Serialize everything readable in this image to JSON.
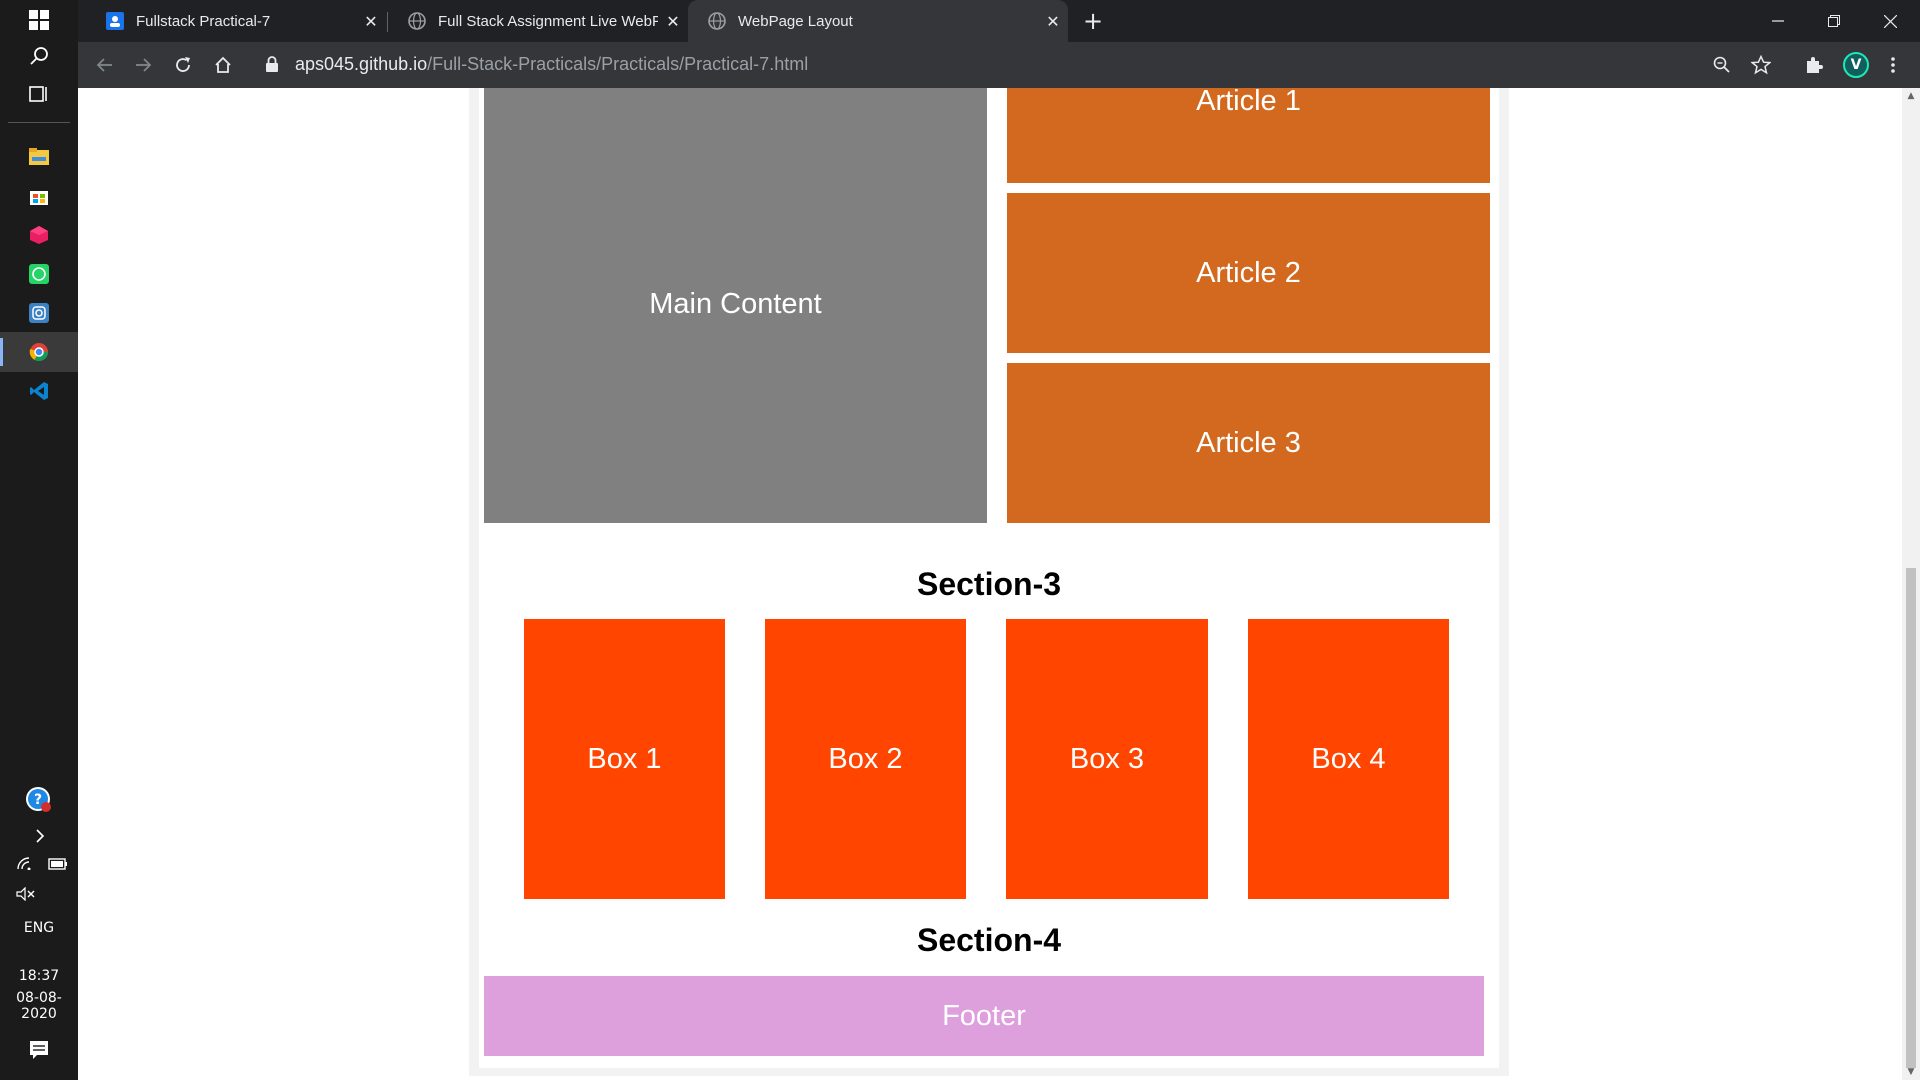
{
  "taskbar": {
    "lang": "ENG",
    "time": "18:37",
    "date": "08-08-2020"
  },
  "browser": {
    "tabs": [
      {
        "title": "Fullstack Practical-7",
        "favicon": "google-classroom-icon",
        "active": false
      },
      {
        "title": "Full Stack Assignment Live WebP",
        "favicon": "globe-icon",
        "active": false
      },
      {
        "title": "WebPage Layout",
        "favicon": "globe-icon",
        "active": true
      }
    ],
    "url_host": "aps045.github.io",
    "url_path": "/Full-Stack-Practicals/Practicals/Practical-7.html",
    "profile_initial": "V"
  },
  "page": {
    "main_content": "Main Content",
    "articles": [
      "Article 1",
      "Article 2",
      "Article 3"
    ],
    "section3_title": "Section-3",
    "boxes": [
      "Box 1",
      "Box 2",
      "Box 3",
      "Box 4"
    ],
    "section4_title": "Section-4",
    "footer": "Footer"
  },
  "colors": {
    "main_content": "#808080",
    "article": "#d2691e",
    "box": "#ff4500",
    "footer": "#dda0dd"
  }
}
